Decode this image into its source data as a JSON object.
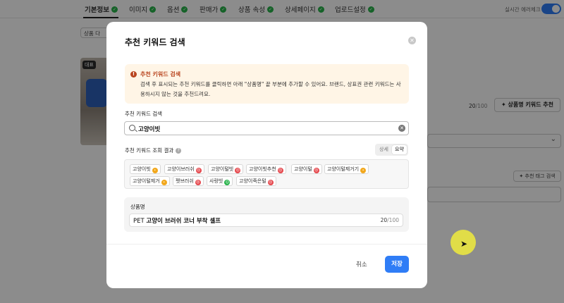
{
  "header": {
    "tabs": [
      {
        "label": "기본정보",
        "active": true
      },
      {
        "label": "이미지"
      },
      {
        "label": "옵션"
      },
      {
        "label": "판매가"
      },
      {
        "label": "상품 속성"
      },
      {
        "label": "상세페이지"
      },
      {
        "label": "업로드설정"
      }
    ],
    "realtime_label": "실시간 에러체크"
  },
  "background": {
    "chip_label": "상품 다",
    "badge": "대표",
    "name_count": "20",
    "name_max": "/100",
    "keyword_btn": "상품명 키워드 추천",
    "tag_btn": "추천 태그 검색"
  },
  "modal": {
    "title": "추천 키워드 검색",
    "notice_title": "추천 키워드 검색",
    "notice_text": "검색 후 표시되는 추천 키워드를 클릭하면 아래 \"상품명\" 끝 부분에 추가할 수 있어요. 브랜드, 상표권 관련 키워드는 사용하시지 않는 것을 추천드려요.",
    "search_label": "추천 키워드 검색",
    "search_value": "고양이빗",
    "results_label": "추천 키워드 조회 결과",
    "toggle": {
      "detail": "상세",
      "summary": "요약",
      "selected": "summary"
    },
    "keywords": [
      {
        "text": "고양이빗",
        "mood": "neutral"
      },
      {
        "text": "고양이브러쉬",
        "mood": "bad"
      },
      {
        "text": "고양이털빗",
        "mood": "bad"
      },
      {
        "text": "고양이빗추천",
        "mood": "bad"
      },
      {
        "text": "고양이털",
        "mood": "bad"
      },
      {
        "text": "고양이털제거기",
        "mood": "neutral"
      },
      {
        "text": "고양이털제거",
        "mood": "neutral"
      },
      {
        "text": "펫브러쉬",
        "mood": "bad"
      },
      {
        "text": "사랑빗",
        "mood": "good"
      },
      {
        "text": "고양이죽은털",
        "mood": "bad"
      }
    ],
    "product_name_label": "상품명",
    "product_name_prefix": "PET",
    "product_name_bold": "고양이 브러쉬 코너 부착 셀프",
    "product_name_count": "20",
    "product_name_max": "/100",
    "cancel": "취소",
    "save": "저장"
  },
  "colors": {
    "accent": "#2f7df6",
    "good": "#27b24a",
    "neutral": "#f2a81d",
    "bad": "#e5484d",
    "notice_bg": "#fff5e6",
    "notice_title": "#b9451f"
  }
}
